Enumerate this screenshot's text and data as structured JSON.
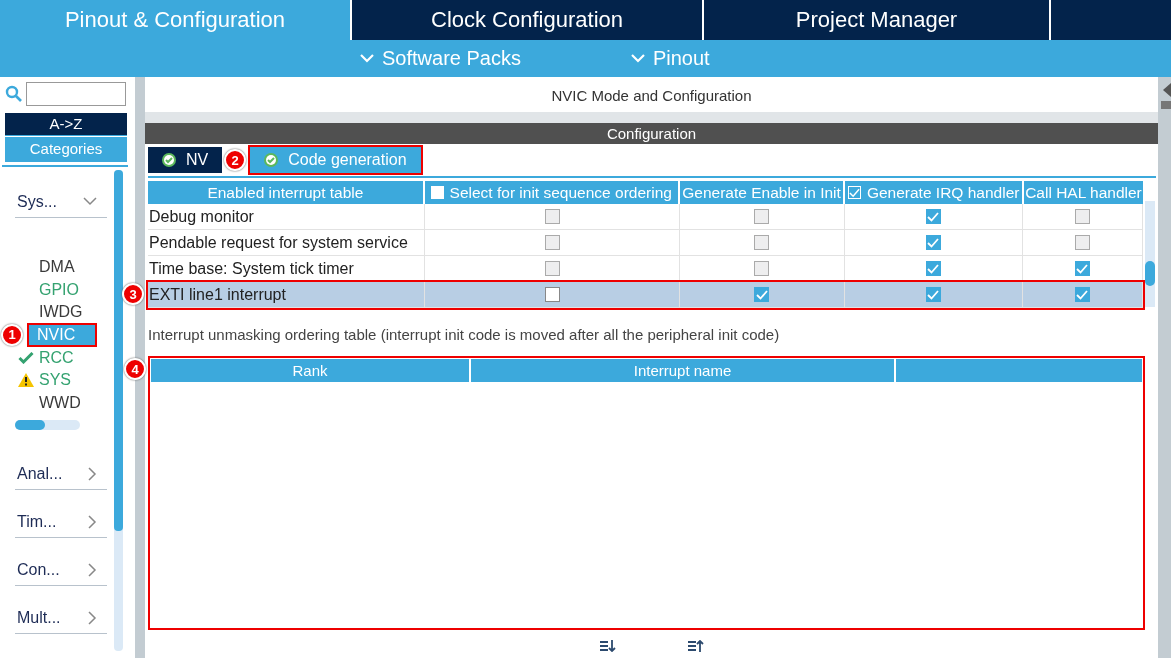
{
  "tabs": [
    {
      "label": "Pinout & Configuration",
      "selected": true
    },
    {
      "label": "Clock Configuration",
      "selected": false
    },
    {
      "label": "Project Manager",
      "selected": false
    }
  ],
  "menus": [
    {
      "label": "Software Packs"
    },
    {
      "label": "Pinout"
    }
  ],
  "sidebar": {
    "sort_buttons": [
      {
        "label": "A->Z",
        "selected": false
      },
      {
        "label": "Categories",
        "selected": true
      }
    ],
    "categories": [
      {
        "label": "Sys...",
        "expanded": true,
        "children": [
          {
            "label": "DMA",
            "configured": false,
            "kind": "plain",
            "selected": false
          },
          {
            "label": "GPIO",
            "configured": true,
            "kind": "plain",
            "selected": false
          },
          {
            "label": "IWDG",
            "configured": false,
            "kind": "plain",
            "selected": false
          },
          {
            "label": "NVIC",
            "configured": false,
            "kind": "plain",
            "selected": true,
            "callout": "1"
          },
          {
            "label": "RCC",
            "configured": true,
            "kind": "check",
            "selected": false
          },
          {
            "label": "SYS",
            "configured": true,
            "kind": "warning",
            "selected": false
          },
          {
            "label": "WWD",
            "configured": false,
            "kind": "plain",
            "selected": false
          }
        ]
      },
      {
        "label": "Anal...",
        "expanded": false
      },
      {
        "label": "Tim...",
        "expanded": false
      },
      {
        "label": "Con...",
        "expanded": false
      },
      {
        "label": "Mult...",
        "expanded": false
      }
    ]
  },
  "panel": {
    "title": "NVIC Mode and Configuration",
    "section": "Configuration",
    "subtabs": [
      {
        "label": "NV",
        "selected": false
      },
      {
        "label": "Code generation",
        "selected": true,
        "callout": "2"
      }
    ],
    "table": {
      "columns": [
        {
          "label": "Enabled interrupt table",
          "kind": "text"
        },
        {
          "label": "Select for init sequence ordering",
          "kind": "check",
          "checked": false
        },
        {
          "label": "Generate Enable in Init",
          "kind": "text"
        },
        {
          "label": "Generate IRQ handler",
          "kind": "check",
          "checked": true
        },
        {
          "label": "Call HAL handler",
          "kind": "text"
        }
      ],
      "rows": [
        {
          "name": "Debug monitor",
          "selected": false,
          "cells": [
            {
              "checked": false,
              "disabled": true
            },
            {
              "checked": false,
              "disabled": true
            },
            {
              "checked": true,
              "disabled": false
            },
            {
              "checked": false,
              "disabled": true
            }
          ]
        },
        {
          "name": "Pendable request for system service",
          "selected": false,
          "cells": [
            {
              "checked": false,
              "disabled": true
            },
            {
              "checked": false,
              "disabled": true
            },
            {
              "checked": true,
              "disabled": false
            },
            {
              "checked": false,
              "disabled": true
            }
          ]
        },
        {
          "name": "Time base: System tick timer",
          "selected": false,
          "cells": [
            {
              "checked": false,
              "disabled": true
            },
            {
              "checked": false,
              "disabled": true
            },
            {
              "checked": true,
              "disabled": false
            },
            {
              "checked": true,
              "disabled": false
            }
          ]
        },
        {
          "name": "EXTI line1 interrupt",
          "selected": true,
          "callout": "3",
          "cells": [
            {
              "checked": false,
              "disabled": false
            },
            {
              "checked": true,
              "disabled": false
            },
            {
              "checked": true,
              "disabled": false
            },
            {
              "checked": true,
              "disabled": false
            }
          ]
        }
      ]
    },
    "ordering": {
      "caption": "Interrupt unmasking ordering table (interrupt init code is moved after all the peripheral init code)",
      "callout": "4",
      "columns": [
        {
          "kind": "text",
          "label": "Rank"
        },
        {
          "kind": "text",
          "label": "Interrupt name"
        },
        {
          "kind": "blank"
        }
      ]
    }
  }
}
